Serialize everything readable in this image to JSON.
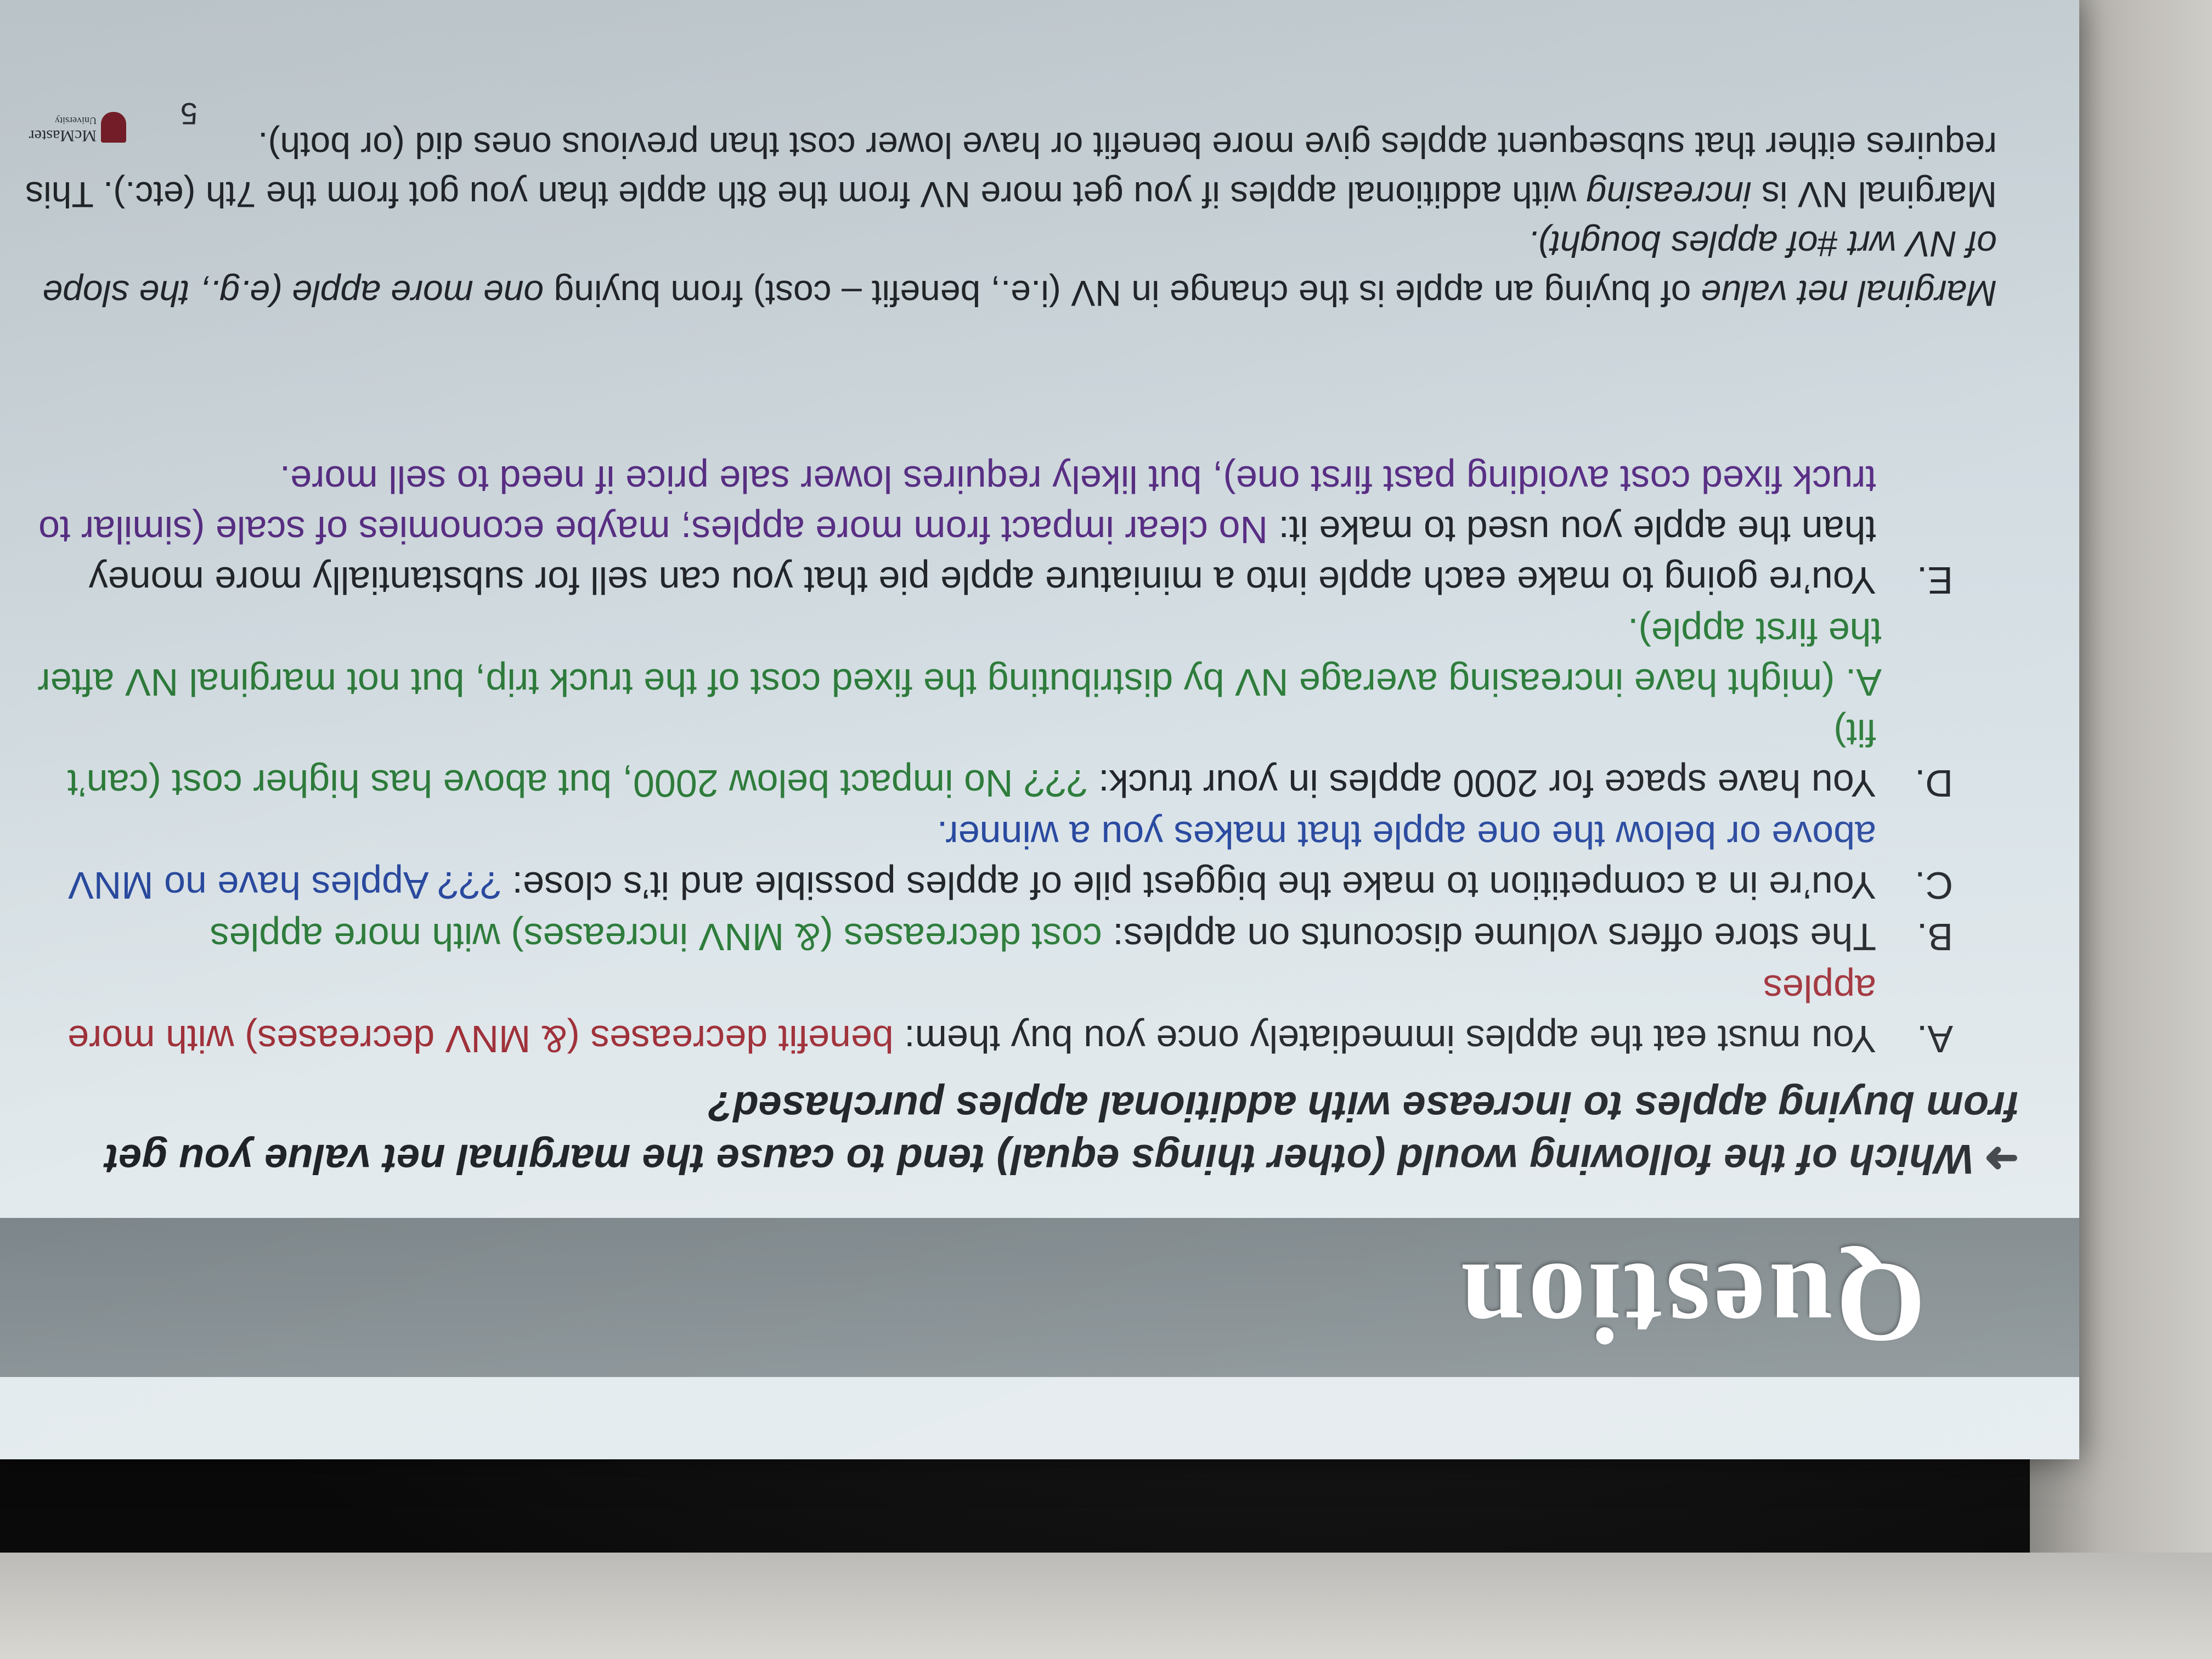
{
  "slide": {
    "title": "Question",
    "question_arrow": "➜",
    "question": "Which of the following would (other things equal) tend to cause the marginal net value you get from buying apples to increase with additional apples purchased?",
    "options": [
      {
        "letter": "A.",
        "text": "You must eat the apples immediately once you buy them: ",
        "answer": "benefit decreases (& MNV decreases) with more apples",
        "answer_color": "red"
      },
      {
        "letter": "B.",
        "text": "The store offers volume discounts on apples: ",
        "answer": "cost decreases (& MNV increases) with more apples",
        "answer_color": "green"
      },
      {
        "letter": "C.",
        "text": "You’re in a competition to make the biggest pile of apples possible and it’s close: ",
        "answer": "??? Apples have no MNV above or below the one apple that makes you a winner.",
        "answer_color": "blue"
      },
      {
        "letter": "D.",
        "text": "You have space for 2000 apples in your truck: ",
        "answer": "??? No impact below 2000, but above has higher cost (can’t fit)",
        "answer2": "A.  (might have increasing average NV by distributing the fixed cost of the truck trip, but not marginal NV after the first apple).",
        "answer_color": "green"
      },
      {
        "letter": "E.",
        "text": "You’re going to make each apple into a miniature apple pie that you can sell for substantially more money than the apple you used to make it: ",
        "answer": "No clear impact from more apples; maybe economies of scale (similar to truck fixed cost avoiding past first one), but likely requires lower sale price if need to sell more.",
        "answer_color": "purple"
      }
    ],
    "note_lead": "Marginal net value",
    "note_body": " of buying an apple is the change in NV (i.e., benefit – cost) from buying ",
    "note_em2": "one more apple (e.g., the slope of NV wrt #of apples bought).",
    "note_2": "Marginal NV is ",
    "note_em3": "increasing",
    "note_3": " with additional apples if you get more NV from the 8th apple than you got from the 7th (etc.).  This requires either that subsequent apples give more benefit or have lower cost than previous ones did (or both).",
    "page_number": "5",
    "logo_text": "McMaster",
    "logo_sub": "University"
  }
}
